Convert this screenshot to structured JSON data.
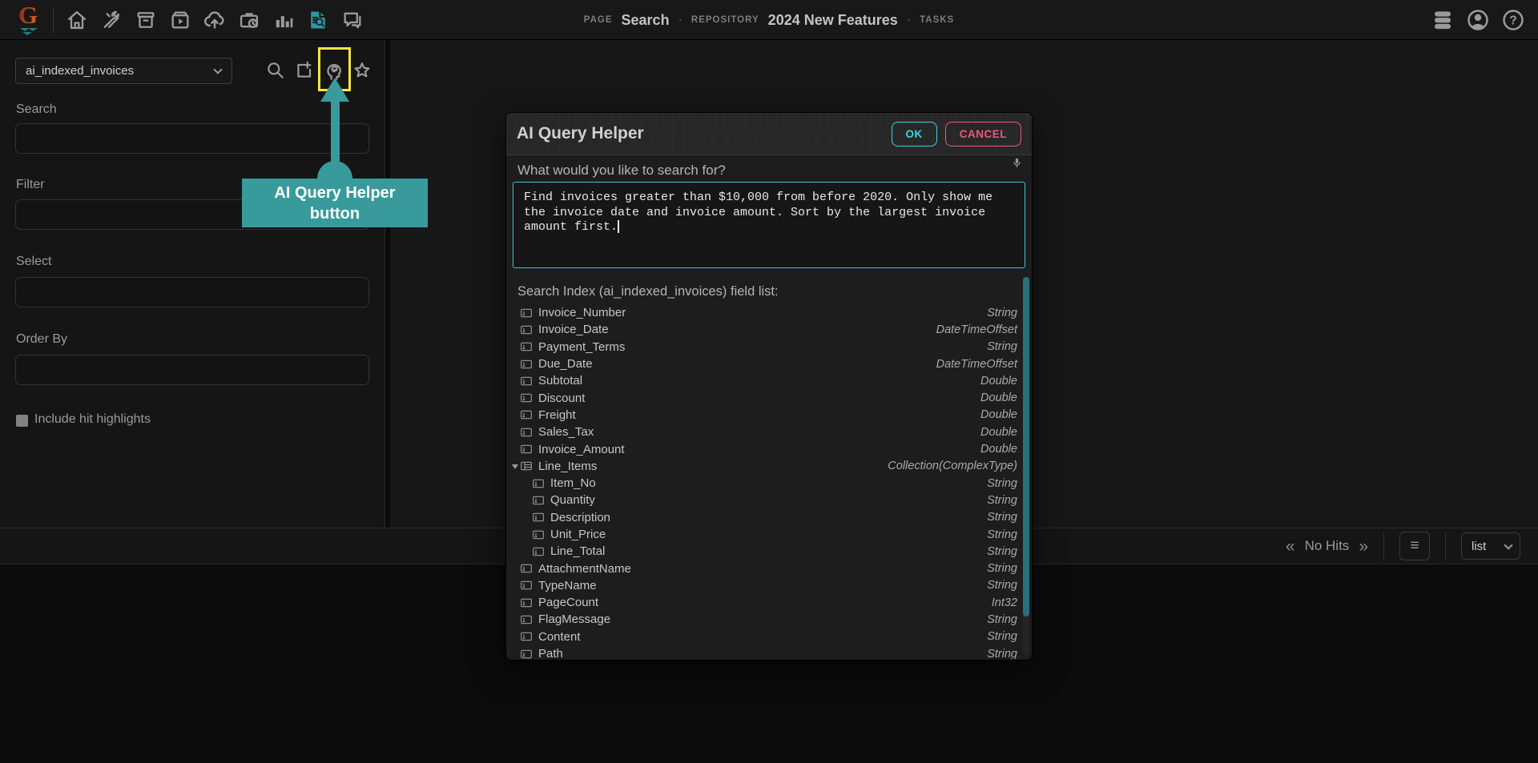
{
  "topbar": {
    "page_label": "PAGE",
    "page_value": "Search",
    "sep": "·",
    "repository_label": "REPOSITORY",
    "repository_value": "2024 New Features",
    "tasks_label": "TASKS",
    "left_icons": [
      "home-icon",
      "tools-icon",
      "archive-box-icon",
      "video-box-icon",
      "cloud-upload-icon",
      "briefcase-clock-icon",
      "bar-chart-icon",
      "document-search-icon",
      "messages-icon"
    ],
    "right_icons": [
      "database-icon",
      "account-icon",
      "help-icon"
    ]
  },
  "sidebar": {
    "archive_select_value": "ai_indexed_invoices",
    "icons": [
      "search-icon",
      "export-new-icon",
      "ai-query-helper-icon",
      "favorites-star-icon"
    ],
    "search_label": "Search",
    "filter_label": "Filter",
    "select_label": "Select",
    "order_by_label": "Order By",
    "include_hit_highlights_label": "Include hit highlights",
    "include_hit_highlights_checked": false
  },
  "callout": {
    "line1": "AI Query Helper",
    "line2": "button"
  },
  "modal": {
    "title": "AI Query Helper",
    "ok_label": "OK",
    "cancel_label": "CANCEL",
    "question_label": "What would you like to search for?",
    "mic_icon": "microphone-icon",
    "query_text": "Find invoices greater than $10,000 from before 2020. Only show me the invoice date and invoice amount. Sort by the largest invoice amount first.",
    "field_list_header": "Search Index (ai_indexed_invoices) field list:",
    "fields": [
      {
        "name": "Invoice_Number",
        "type": "String",
        "indent": 0
      },
      {
        "name": "Invoice_Date",
        "type": "DateTimeOffset",
        "indent": 0
      },
      {
        "name": "Payment_Terms",
        "type": "String",
        "indent": 0
      },
      {
        "name": "Due_Date",
        "type": "DateTimeOffset",
        "indent": 0
      },
      {
        "name": "Subtotal",
        "type": "Double",
        "indent": 0
      },
      {
        "name": "Discount",
        "type": "Double",
        "indent": 0
      },
      {
        "name": "Freight",
        "type": "Double",
        "indent": 0
      },
      {
        "name": "Sales_Tax",
        "type": "Double",
        "indent": 0
      },
      {
        "name": "Invoice_Amount",
        "type": "Double",
        "indent": 0
      },
      {
        "name": "Line_Items",
        "type": "Collection(ComplexType)",
        "indent": 0,
        "expanded": true,
        "icon": "table"
      },
      {
        "name": "Item_No",
        "type": "String",
        "indent": 1
      },
      {
        "name": "Quantity",
        "type": "String",
        "indent": 1
      },
      {
        "name": "Description",
        "type": "String",
        "indent": 1
      },
      {
        "name": "Unit_Price",
        "type": "String",
        "indent": 1
      },
      {
        "name": "Line_Total",
        "type": "String",
        "indent": 1
      },
      {
        "name": "AttachmentName",
        "type": "String",
        "indent": 0
      },
      {
        "name": "TypeName",
        "type": "String",
        "indent": 0
      },
      {
        "name": "PageCount",
        "type": "Int32",
        "indent": 0
      },
      {
        "name": "FlagMessage",
        "type": "String",
        "indent": 0
      },
      {
        "name": "Content",
        "type": "String",
        "indent": 0
      },
      {
        "name": "Path",
        "type": "String",
        "indent": 0
      }
    ]
  },
  "toolbar": {
    "prev_glyph": "«",
    "no_hits_label": "No Hits",
    "next_glyph": "»",
    "menu_glyph": "≡",
    "view_select_value": "list"
  },
  "colors": {
    "annotation_teal": "#389a9b",
    "highlight_yellow": "#f2e73a",
    "ok_cyan": "#3ed3e3",
    "cancel_pink": "#ee5880",
    "textarea_border_cyan": "#43c1d4",
    "scrollbar_teal": "#2c6f7c",
    "document_search_icon_teal": "#2f97a3"
  }
}
